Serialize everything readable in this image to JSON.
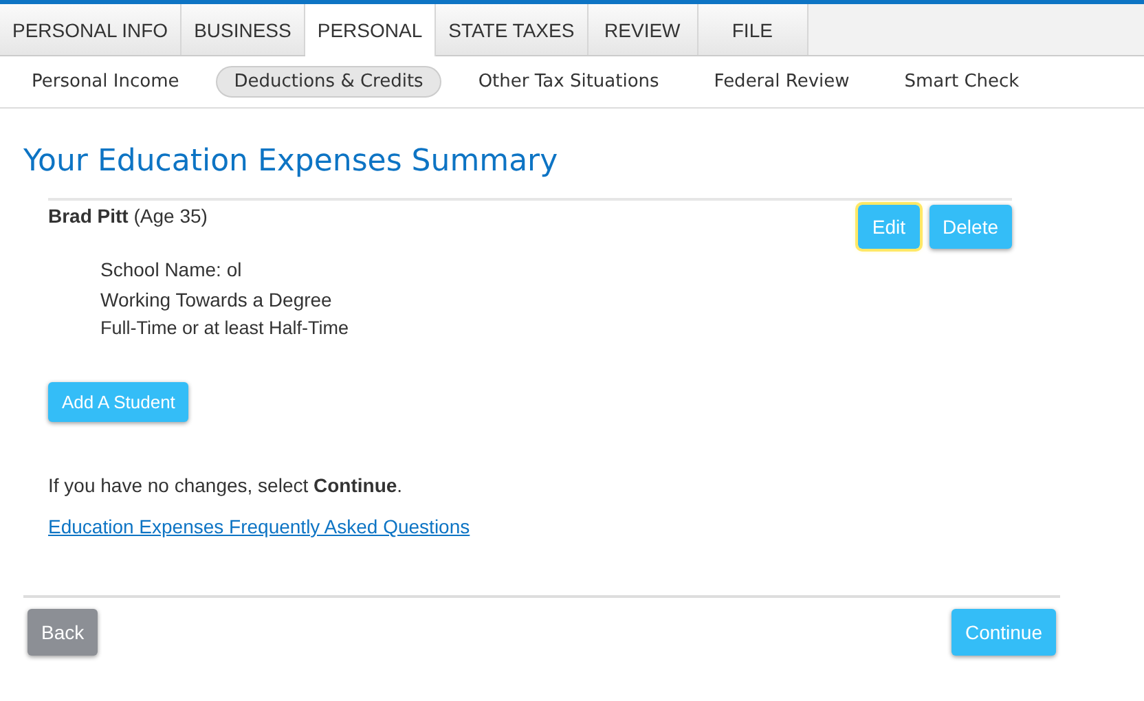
{
  "tabs": [
    {
      "label": "PERSONAL INFO",
      "selected": false
    },
    {
      "label": "BUSINESS",
      "selected": false
    },
    {
      "label": "PERSONAL",
      "selected": true
    },
    {
      "label": "STATE TAXES",
      "selected": false
    },
    {
      "label": "REVIEW",
      "selected": false
    },
    {
      "label": "FILE",
      "selected": false
    }
  ],
  "subnav": [
    {
      "label": "Personal Income",
      "selected": false
    },
    {
      "label": "Deductions & Credits",
      "selected": true
    },
    {
      "label": "Other Tax Situations",
      "selected": false
    },
    {
      "label": "Federal Review",
      "selected": false
    },
    {
      "label": "Smart Check",
      "selected": false
    }
  ],
  "page_title": "Your Education Expenses Summary",
  "students": [
    {
      "name": "**Brad Pitt** (Age 35)",
      "details": [
        "School Name: ol",
        "Working Towards a Degree",
        "Full-Time or at least Half-Time"
      ],
      "buttons": [
        {
          "label": "Edit",
          "focused": true
        },
        {
          "label": "Delete",
          "focused": false
        }
      ]
    }
  ],
  "add_button": "Add A Student",
  "instruction": "If you have no changes, select **Continue**.",
  "faq_link": "Education Expenses Frequently Asked Questions",
  "footer": {
    "back": "Back",
    "continue": "Continue"
  }
}
